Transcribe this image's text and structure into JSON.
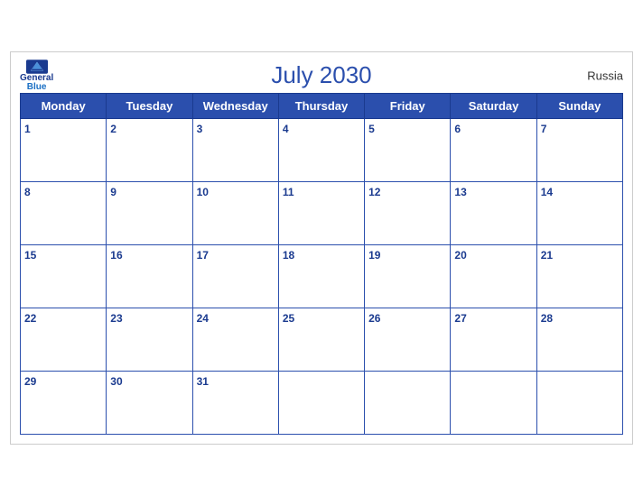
{
  "calendar": {
    "title": "July 2030",
    "country": "Russia",
    "logo": {
      "line1": "General",
      "line2": "Blue"
    },
    "days_of_week": [
      "Monday",
      "Tuesday",
      "Wednesday",
      "Thursday",
      "Friday",
      "Saturday",
      "Sunday"
    ],
    "weeks": [
      [
        1,
        2,
        3,
        4,
        5,
        6,
        7
      ],
      [
        8,
        9,
        10,
        11,
        12,
        13,
        14
      ],
      [
        15,
        16,
        17,
        18,
        19,
        20,
        21
      ],
      [
        22,
        23,
        24,
        25,
        26,
        27,
        28
      ],
      [
        29,
        30,
        31,
        null,
        null,
        null,
        null
      ]
    ]
  }
}
